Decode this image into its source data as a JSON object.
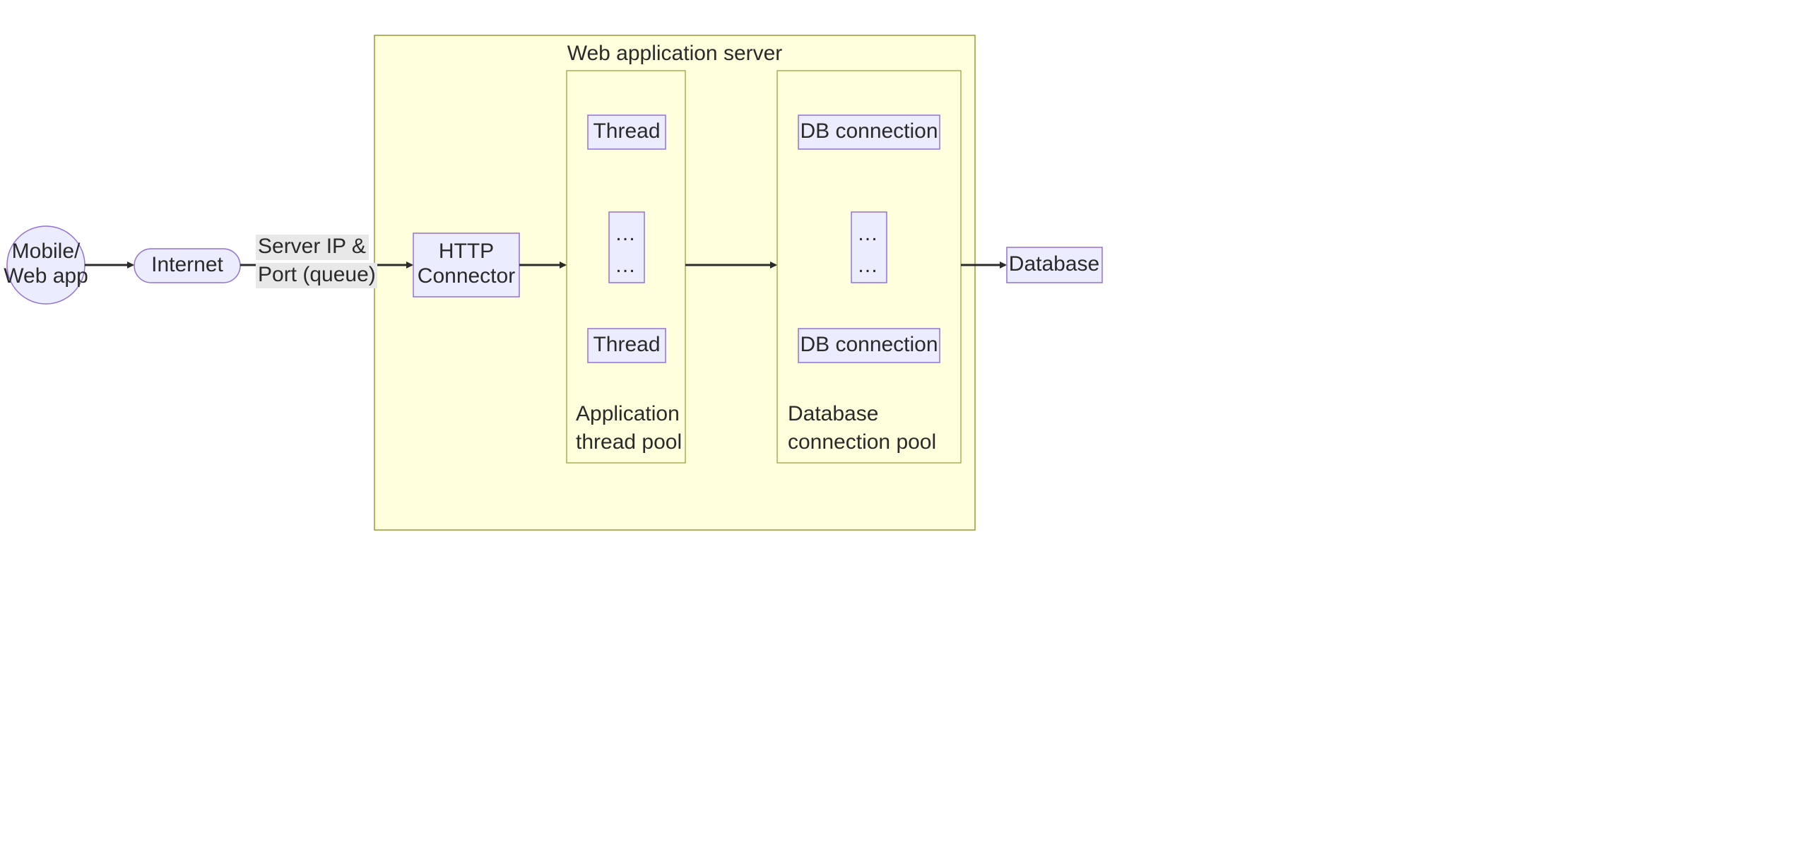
{
  "nodes": {
    "client": {
      "line1": "Mobile/",
      "line2": "Web app"
    },
    "internet": "Internet",
    "http_connector": {
      "line1": "HTTP",
      "line2": "Connector"
    },
    "database": "Database",
    "thread_top": "Thread",
    "thread_bottom": "Thread",
    "db_conn_top": "DB connection",
    "db_conn_bottom": "DB connection",
    "ellipsis": "…"
  },
  "groups": {
    "server": "Web application server",
    "thread_pool": {
      "line1": "Application",
      "line2": "thread pool"
    },
    "conn_pool": {
      "line1": "Database",
      "line2": "connection pool"
    }
  },
  "edges": {
    "ip_port": {
      "line1": "Server IP &",
      "line2": "Port (queue)"
    }
  }
}
